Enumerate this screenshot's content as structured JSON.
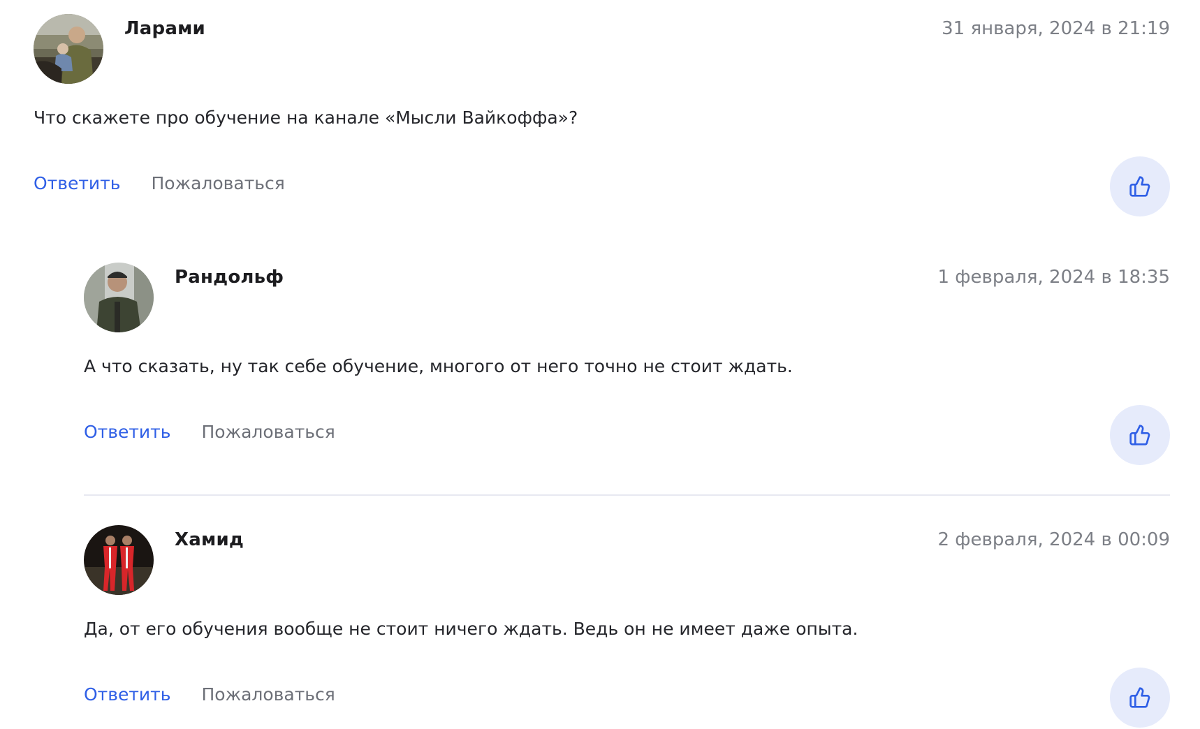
{
  "comments": [
    {
      "author": "Ларами",
      "date": "31 января, 2024 в 21:19",
      "text": "Что скажете про обучение на канале «Мысли Вайкоффа»?",
      "reply_label": "Ответить",
      "complain_label": "Пожаловаться",
      "avatar_icon": "user-photo-icon",
      "like_icon": "thumbs-up-icon"
    },
    {
      "author": "Рандольф",
      "date": "1 февраля, 2024 в 18:35",
      "text": "А что сказать, ну так себе обучение, многого от него точно не стоит ждать.",
      "reply_label": "Ответить",
      "complain_label": "Пожаловаться",
      "avatar_icon": "user-photo-icon",
      "like_icon": "thumbs-up-icon"
    },
    {
      "author": "Хамид",
      "date": "2 февраля, 2024 в 00:09",
      "text": "Да, от его обучения вообще не стоит ничего ждать. Ведь он не имеет даже опыта.",
      "reply_label": "Ответить",
      "complain_label": "Пожаловаться",
      "avatar_icon": "user-photo-icon",
      "like_icon": "thumbs-up-icon"
    }
  ],
  "colors": {
    "accent": "#2f5fe6",
    "like_bg": "#e6ebfb",
    "muted": "#6d7078",
    "date": "#7c7f86"
  }
}
